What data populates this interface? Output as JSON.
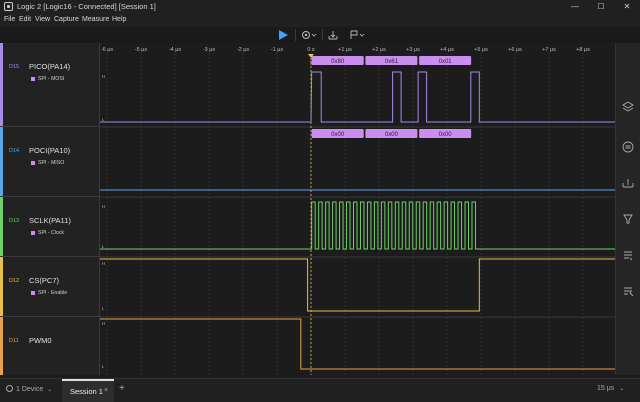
{
  "window": {
    "title": "Logic 2 [Logic16 - Connected] [Session 1]"
  },
  "menu": [
    "File",
    "Edit",
    "View",
    "Capture",
    "Measure",
    "Help"
  ],
  "time_axis": {
    "labels": [
      "-6 μs",
      "-5 μs",
      "-4 μs",
      "-3 μs",
      "-2 μs",
      "-1 μs",
      "0 s",
      "+1 μs",
      "+2 μs",
      "+3 μs",
      "+4 μs",
      "+5 μs",
      "+6 μs",
      "+7 μs",
      "+8 μs"
    ],
    "trigger_marker": "T"
  },
  "channels": [
    {
      "num": "D15",
      "name": "PICO(PA14)",
      "analyzer": "SPI - MOSI",
      "color": "#a98ae8",
      "high": "H",
      "low": "L",
      "decoded": [
        "0x80",
        "0x61",
        "0x01"
      ]
    },
    {
      "num": "D14",
      "name": "POCI(PA10)",
      "analyzer": "SPI - MISO",
      "color": "#5aa7e8",
      "high": "",
      "low": "",
      "decoded": [
        "0x00",
        "0x00",
        "0x00"
      ]
    },
    {
      "num": "D13",
      "name": "SCLK(PA11)",
      "analyzer": "SPI - Clock",
      "color": "#6fcf6a",
      "high": "H",
      "low": "L",
      "decoded": []
    },
    {
      "num": "D12",
      "name": "CS(PC7)",
      "analyzer": "SPI - Enable",
      "color": "#e8c14a",
      "high": "H",
      "low": "L",
      "decoded": []
    },
    {
      "num": "D11",
      "name": "PWM0",
      "analyzer": "",
      "color": "#e8a14a",
      "high": "H",
      "low": "L",
      "decoded": []
    }
  ],
  "analyzer_color": "#c98ef0",
  "bottom": {
    "device": "1 Device",
    "session": "Session 1",
    "close": "×",
    "add": "+",
    "zoom": "15 μs"
  }
}
